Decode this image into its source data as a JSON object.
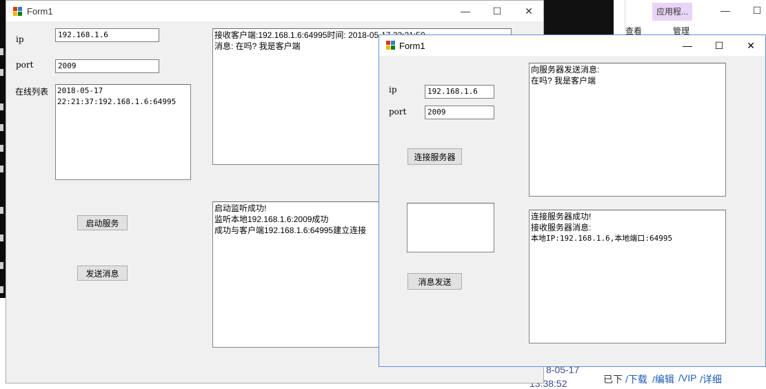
{
  "background": {
    "explorer_tabs": {
      "view": "查看",
      "manage": "管理",
      "app_tag": "应用程..."
    },
    "bottom_bar": {
      "date": "8-05-17",
      "time": "13:38:52",
      "status": "已下",
      "links": [
        "/下载",
        "/编辑",
        "/VIP",
        "/详细"
      ]
    }
  },
  "server_form": {
    "title": "Form1",
    "labels": {
      "ip": "ip",
      "port": "port",
      "online_list": "在线列表"
    },
    "ip_value": "192.168.1.6",
    "port_value": "2009",
    "online_list": [
      "2018-05-17",
      "22:21:37:192.168.1.6:64995"
    ],
    "receive_log": [
      "接收客户端:192.168.1.6:64995时间: 2018-05-17 22:21:50",
      "消息: 在吗? 我是客户端"
    ],
    "status_log": [
      "启动监听成功!",
      "监听本地192.168.1.6:2009成功",
      "成功与客户端192.168.1.6:64995建立连接"
    ],
    "buttons": {
      "start": "启动服务",
      "send": "发送消息"
    }
  },
  "client_form": {
    "title": "Form1",
    "labels": {
      "ip": "ip",
      "port": "port"
    },
    "ip_value": "192.168.1.6",
    "port_value": "2009",
    "send_log": [
      "向服务器发送消息:",
      "在吗? 我是客户端"
    ],
    "status_log": [
      "连接服务器成功!",
      "接收服务器消息:",
      "本地IP:192.168.1.6,本地端口:64995"
    ],
    "message_input": "",
    "buttons": {
      "connect": "连接服务器",
      "send": "消息发送"
    }
  },
  "window_controls": {
    "minimize": "—",
    "maximize": "☐",
    "close": "✕"
  }
}
